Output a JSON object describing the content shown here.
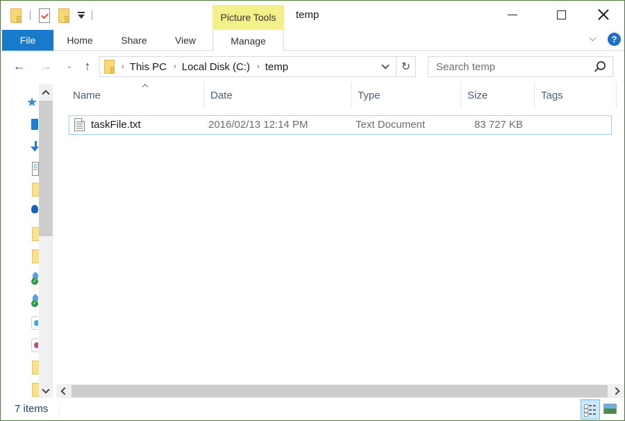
{
  "window": {
    "title": "temp",
    "context_tab_header": "Picture Tools",
    "controls": {
      "minimize": "minimize-icon",
      "maximize": "maximize-icon",
      "close": "close-icon"
    }
  },
  "quick_access_toolbar": {
    "icons": [
      "folder-icon",
      "properties-icon",
      "new-folder-icon",
      "customize-dropdown-icon"
    ]
  },
  "ribbon": {
    "tabs": [
      {
        "label": "File",
        "active": true
      },
      {
        "label": "Home"
      },
      {
        "label": "Share"
      },
      {
        "label": "View"
      },
      {
        "label": "Manage",
        "contextual": true
      }
    ],
    "help_label": "?"
  },
  "navigation": {
    "back": "←",
    "forward": "→",
    "recent": "⌄",
    "up": "↑",
    "refresh": "↻",
    "breadcrumbs": [
      {
        "label": "This PC"
      },
      {
        "label": "Local Disk (C:)"
      },
      {
        "label": "temp"
      }
    ],
    "crumb_separator": "›",
    "search": {
      "placeholder": "Search temp",
      "value": ""
    }
  },
  "nav_pane": {
    "icons": [
      "quick-access-star-icon",
      "desktop-icon",
      "downloads-icon",
      "documents-icon",
      "folder-icon",
      "onedrive-icon",
      "folder-icon",
      "folder-icon",
      "synced-folder-icon",
      "synced-folder-icon",
      "app-icon",
      "app-icon",
      "folder-icon",
      "folder-icon"
    ]
  },
  "file_list": {
    "columns": [
      {
        "label": "Name",
        "sorted": "ascending"
      },
      {
        "label": "Date"
      },
      {
        "label": "Type"
      },
      {
        "label": "Size"
      },
      {
        "label": "Tags"
      }
    ],
    "rows": [
      {
        "name": "taskFile.txt",
        "date": "2016/02/13 12:14 PM",
        "type": "Text Document",
        "size": "83 727 KB",
        "tags": "",
        "icon": "text-file-icon",
        "selected": true
      }
    ]
  },
  "status_bar": {
    "item_count": "7 items",
    "views": [
      "details-view-icon",
      "large-icons-view-icon"
    ],
    "active_view": "details"
  },
  "colors": {
    "file_tab": "#1979ca",
    "context_header": "#f3f08a",
    "selection_border": "#99d1ff",
    "window_border": "#4a7a3a",
    "help_button": "#1f6fcf"
  }
}
